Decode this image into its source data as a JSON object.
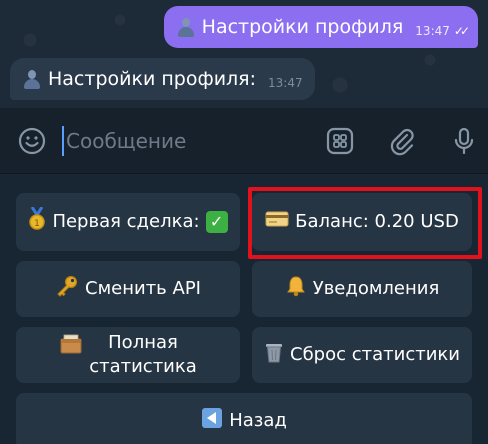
{
  "messages": {
    "outgoing": {
      "text": "Настройки профиля",
      "time": "13:47",
      "ticks": "✓✓"
    },
    "incoming": {
      "text": "Настройки профиля:",
      "time": "13:47"
    }
  },
  "input": {
    "placeholder": "Сообщение",
    "icons": [
      "emoji-icon",
      "sticker-grid-icon",
      "attach-icon",
      "microphone-icon"
    ]
  },
  "keyboard": {
    "first_deal": "Первая сделка:",
    "first_deal_check": "✓",
    "balance": "Баланс: 0.20 USD",
    "change_api": "Сменить API",
    "notifications": "Уведомления",
    "full_stats_line1": "Полная",
    "full_stats_line2": "статистика",
    "reset_stats": "Сброс статистики",
    "back": "Назад"
  },
  "colors": {
    "outgoing_bubble": "#8b6ff0",
    "incoming_bubble": "#2b3a4a",
    "keyboard_button": "#263544",
    "highlight": "#e2121d"
  }
}
